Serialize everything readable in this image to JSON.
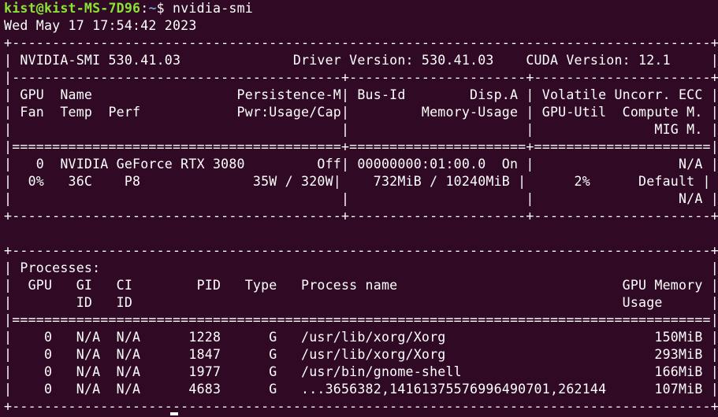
{
  "prompt": {
    "user_host": "kist@kist-MS-7D96",
    "separator": ":",
    "path": "~",
    "symbol": "$",
    "command": " nvidia-smi"
  },
  "date_line": "Wed May 17 17:54:42 2023",
  "output_lines": [
    "+---------------------------------------------------------------------------------------+",
    "| NVIDIA-SMI 530.41.03              Driver Version: 530.41.03    CUDA Version: 12.1     |",
    "|-----------------------------------------+----------------------+----------------------+",
    "| GPU  Name                  Persistence-M| Bus-Id        Disp.A | Volatile Uncorr. ECC |",
    "| Fan  Temp  Perf            Pwr:Usage/Cap|         Memory-Usage | GPU-Util  Compute M. |",
    "|                                         |                      |               MIG M. |",
    "|=========================================+======================+======================|",
    "|   0  NVIDIA GeForce RTX 3080         Off| 00000000:01:00.0  On |                  N/A |",
    "|  0%   36C    P8              35W / 320W|    732MiB / 10240MiB |      2%      Default |",
    "|                                         |                      |                  N/A |",
    "+-----------------------------------------+----------------------+----------------------+",
    "",
    "+---------------------------------------------------------------------------------------+",
    "| Processes:                                                                            |",
    "|  GPU   GI   CI        PID   Type   Process name                            GPU Memory |",
    "|        ID   ID                                                             Usage      |",
    "|=======================================================================================|",
    "|    0   N/A  N/A      1228      G   /usr/lib/xorg/Xorg                          150MiB |",
    "|    0   N/A  N/A      1847      G   /usr/lib/xorg/Xorg                          293MiB |",
    "|    0   N/A  N/A      1977      G   /usr/bin/gnome-shell                        166MiB |",
    "|    0   N/A  N/A      4683      G   ...3656382,14161375576996490701,262144      107MiB |",
    "+---------------------------------------------------------------------------------------+"
  ]
}
